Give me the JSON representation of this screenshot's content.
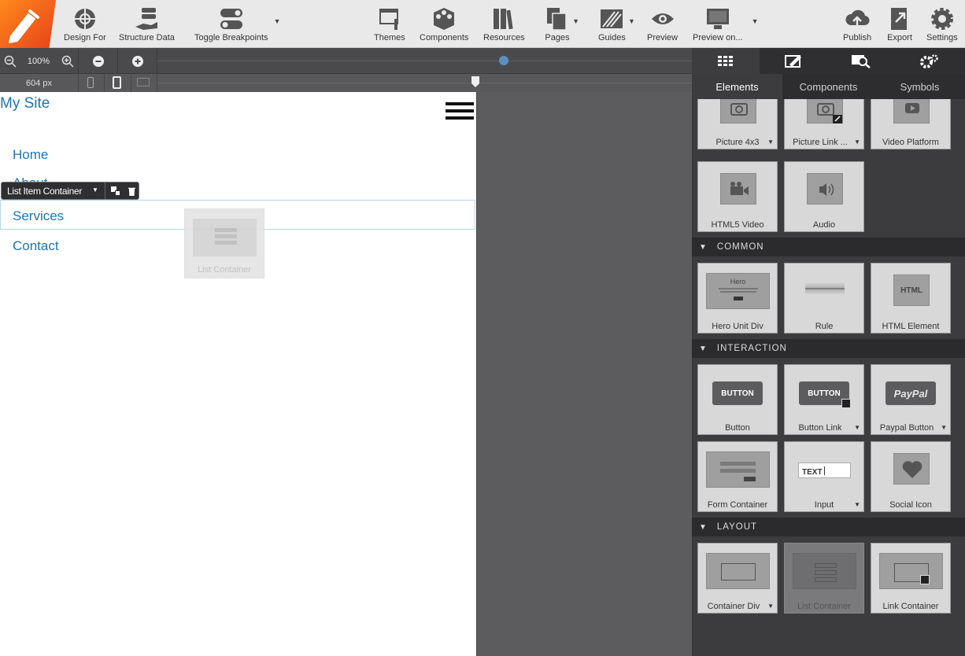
{
  "toolbar": {
    "design_for": "Design For",
    "structure_data": "Structure Data",
    "toggle_breakpoints": "Toggle Breakpoints",
    "themes": "Themes",
    "components": "Components",
    "resources": "Resources",
    "pages": "Pages",
    "guides": "Guides",
    "preview": "Preview",
    "preview_on": "Preview on...",
    "publish": "Publish",
    "export": "Export",
    "settings": "Settings"
  },
  "zoom": {
    "level": "100%",
    "width": "604 px"
  },
  "site": {
    "title": "My Site",
    "nav": [
      "Home",
      "About",
      "Services",
      "Contact"
    ]
  },
  "selection": {
    "label": "List Item Container"
  },
  "drag_ghost": {
    "label": "List Container"
  },
  "panel": {
    "tabs": [
      "Elements",
      "Components",
      "Symbols"
    ],
    "sections": [
      "COMMON",
      "INTERACTION",
      "LAYOUT"
    ],
    "media": [
      "Picture 4x3",
      "Picture Link ...",
      "Video Platform",
      "HTML5 Video",
      "Audio"
    ],
    "common": [
      "Hero Unit Div",
      "Rule",
      "HTML Element"
    ],
    "common_icons": {
      "hero": "Hero",
      "html": "HTML"
    },
    "interaction": [
      "Button",
      "Button Link",
      "Paypal Button",
      "Form Container",
      "Input",
      "Social Icon"
    ],
    "interaction_icons": {
      "button": "BUTTON",
      "paypal": "PayPal",
      "text": "TEXT"
    },
    "layout": [
      "Container Div",
      "List Container",
      "Link Container"
    ]
  },
  "colors": {
    "accent": "#1c74b8",
    "logo": "#f2651f"
  }
}
